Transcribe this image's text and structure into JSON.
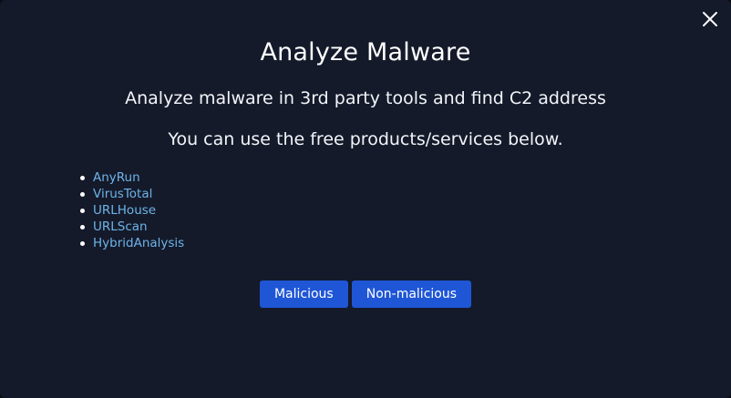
{
  "modal": {
    "title": "Analyze Malware",
    "subtitle": "Analyze malware in 3rd party tools and find C2 address",
    "hint": "You can use the free products/services below.",
    "close_icon": "close-icon",
    "links": [
      {
        "label": "AnyRun"
      },
      {
        "label": "VirusTotal"
      },
      {
        "label": "URLHouse"
      },
      {
        "label": "URLScan"
      },
      {
        "label": "HybridAnalysis"
      }
    ],
    "buttons": {
      "malicious": "Malicious",
      "non_malicious": "Non-malicious"
    }
  },
  "colors": {
    "background": "#141a2a",
    "link": "#6fb3e8",
    "button": "#1f56d6",
    "text": "#ffffff"
  }
}
